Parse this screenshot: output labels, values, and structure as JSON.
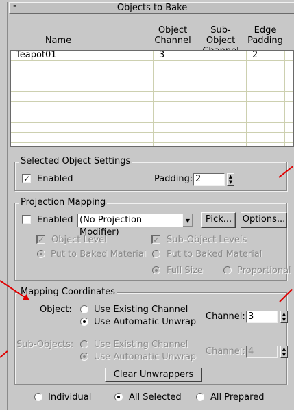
{
  "rollout": {
    "toggle": "-",
    "title": "Objects to Bake"
  },
  "table": {
    "headers": [
      {
        "lines": [
          "",
          "Name"
        ]
      },
      {
        "lines": [
          "Object",
          "Channel"
        ]
      },
      {
        "lines": [
          "Sub-Object",
          "Channel"
        ]
      },
      {
        "lines": [
          "Edge",
          "Padding"
        ]
      }
    ],
    "rows": [
      {
        "name": "Teapot01",
        "object_channel": "3",
        "sub_object_channel": "",
        "edge_padding": "2"
      }
    ]
  },
  "selected_object_settings": {
    "title": "Selected Object Settings",
    "enabled_label": "Enabled",
    "enabled_checked": true,
    "padding_label": "Padding:",
    "padding_value": "2"
  },
  "projection_mapping": {
    "title": "Projection Mapping",
    "enabled_label": "Enabled",
    "enabled_checked": false,
    "modifier_value": "(No Projection Modifier)",
    "pick_label": "Pick...",
    "options_label": "Options...",
    "object_level_label": "Object Level",
    "sub_object_levels_label": "Sub-Object Levels",
    "put_to_baked_left": "Put to Baked Material",
    "put_to_baked_right": "Put to Baked Material",
    "full_size_label": "Full Size",
    "proportional_label": "Proportional"
  },
  "mapping_coordinates": {
    "title": "Mapping Coordinates",
    "object_label": "Object:",
    "use_existing_label": "Use Existing Channel",
    "use_automatic_label": "Use Automatic Unwrap",
    "channel_label": "Channel:",
    "object_channel_value": "3",
    "sub_objects_label": "Sub-Objects:",
    "sub_use_existing_label": "Use Existing Channel",
    "sub_use_automatic_label": "Use Automatic Unwrap",
    "sub_channel_label": "Channel:",
    "sub_channel_value": "4",
    "clear_label": "Clear Unwrappers"
  },
  "bottom": {
    "individual_label": "Individual",
    "all_selected_label": "All Selected",
    "all_prepared_label": "All Prepared"
  },
  "colors": {
    "annotation_arrow": "#e00000",
    "panel": "#c8c8c8",
    "table_grid": "#cdd0b0"
  }
}
